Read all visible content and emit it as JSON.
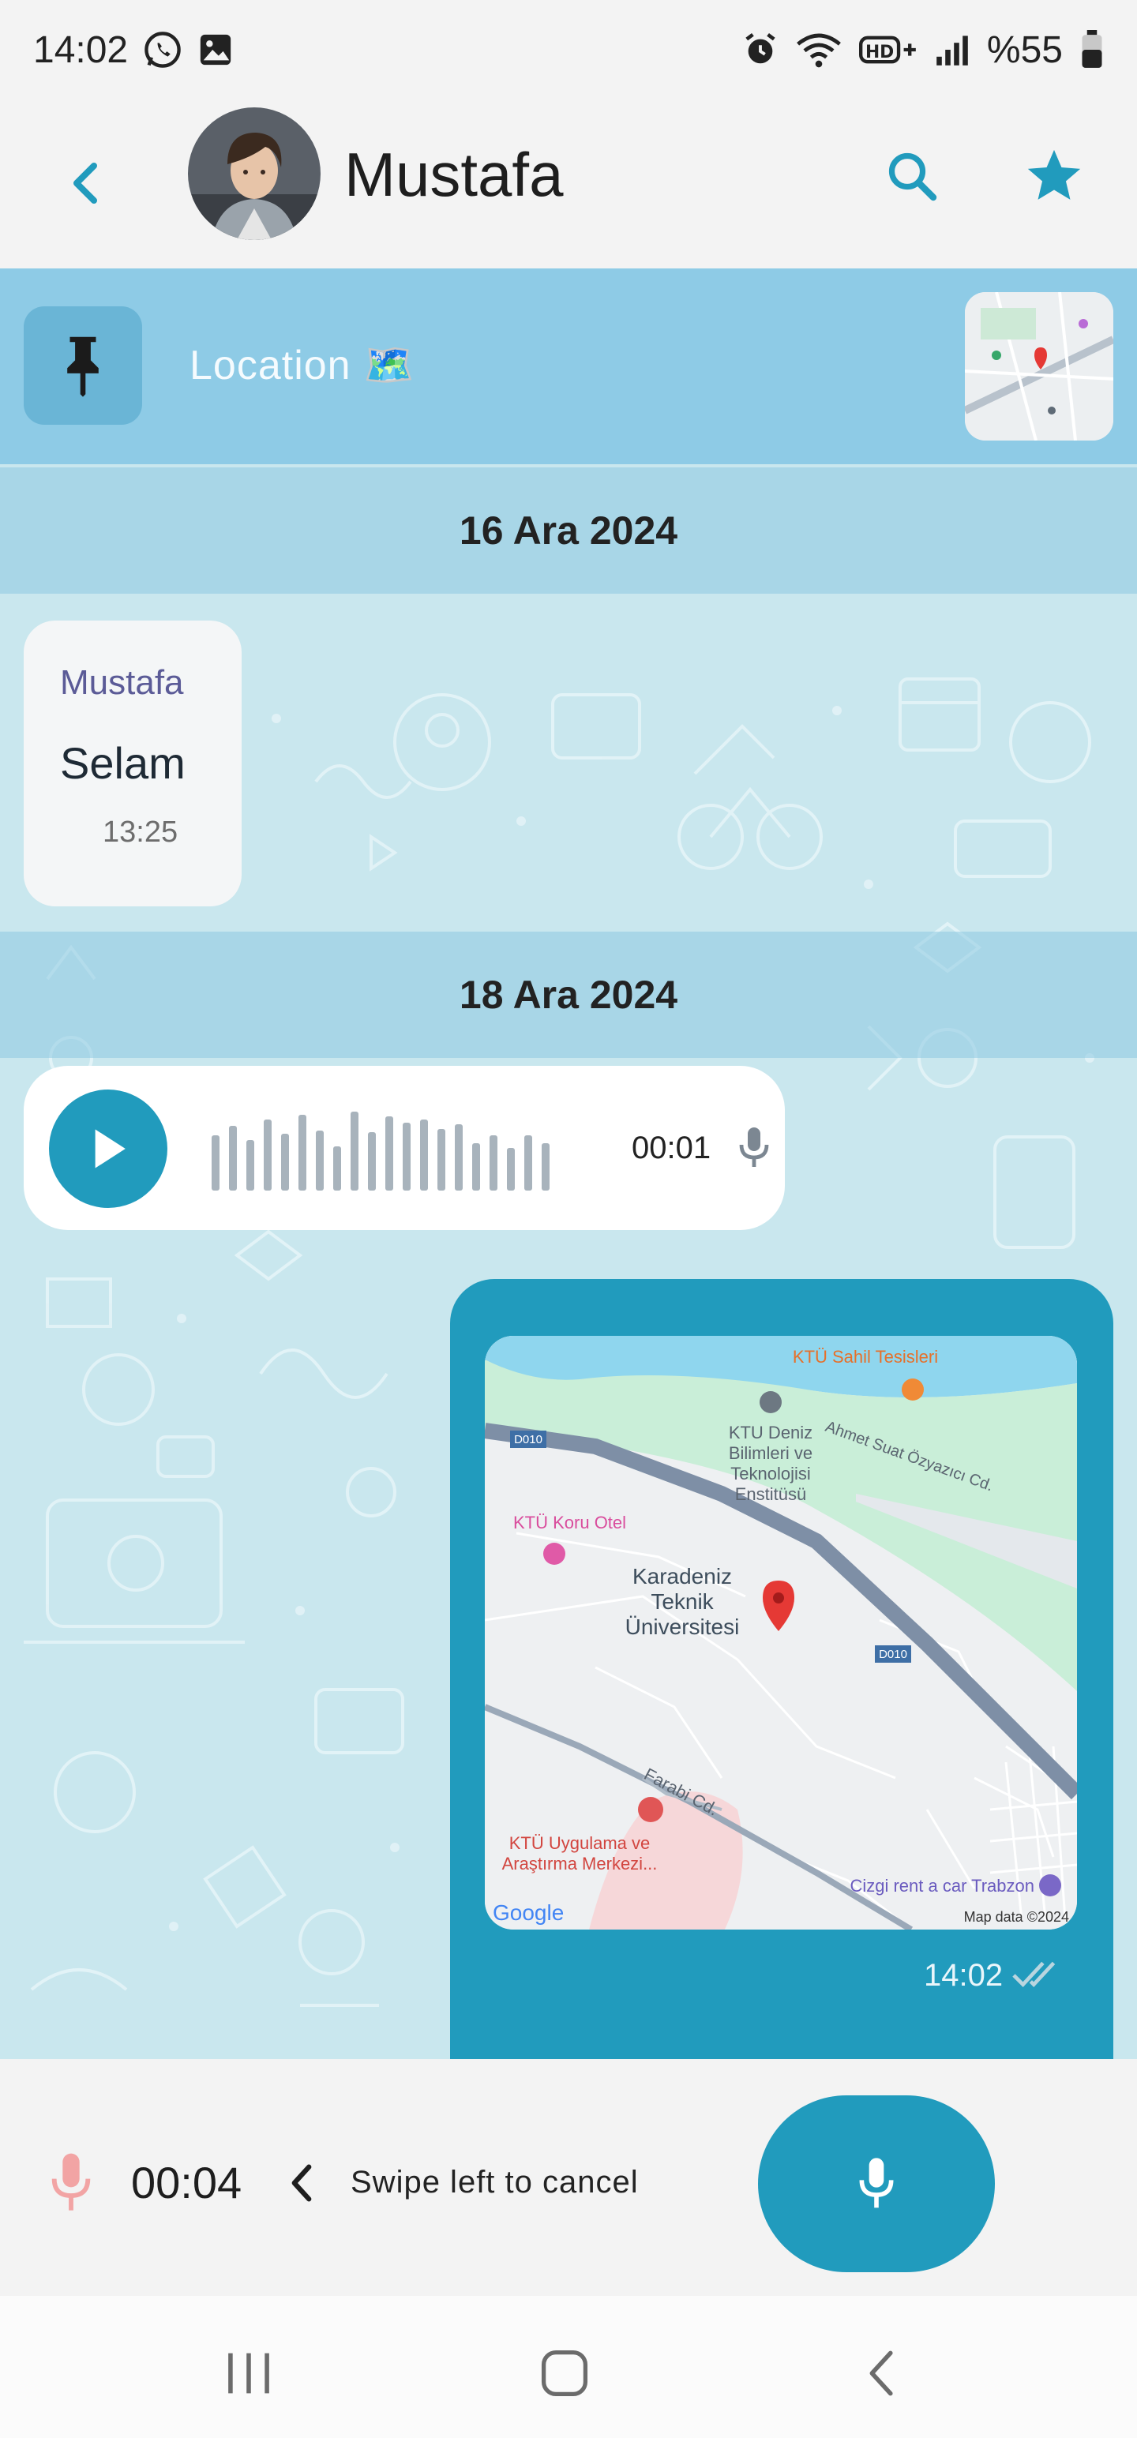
{
  "status_bar": {
    "time": "14:02",
    "battery_text": "%55",
    "icons": [
      "whatsapp-icon",
      "gallery-icon",
      "alarm-icon",
      "wifi-icon",
      "hd-plus-icon",
      "signal-icon",
      "battery-icon"
    ]
  },
  "header": {
    "contact_name": "Mustafa",
    "icons": [
      "back-arrow-icon",
      "search-icon",
      "star-icon"
    ]
  },
  "pinned": {
    "label": "Location 🗺️",
    "icon": "pin-icon"
  },
  "conversation": {
    "date_1": "16 Ara 2024",
    "text_message": {
      "sender": "Mustafa",
      "body": "Selam",
      "time": "13:25"
    },
    "date_2": "18 Ara 2024",
    "voice_message": {
      "duration": "00:01",
      "icons": [
        "play-icon",
        "microphone-icon"
      ]
    },
    "location_message": {
      "time": "14:02",
      "status": "read",
      "map_labels": {
        "poi_1": "KTÜ Sahil Tesisleri",
        "poi_2a": "KTU Deniz",
        "poi_2b": "Bilimleri ve",
        "poi_2c": "Teknolojisi",
        "poi_2d": "Enstitüsü",
        "road_1": "Ahmet Suat Özyazıcı Cd.",
        "road_code_1": "D010",
        "road_code_2": "D010",
        "poi_3": "KTÜ Koru Otel",
        "poi_4a": "Karadeniz",
        "poi_4b": "Teknik",
        "poi_4c": "Üniversitesi",
        "road_2": "Farabi Cd.",
        "poi_5a": "KTÜ Uygulama ve",
        "poi_5b": "Araştırma Merkezi...",
        "poi_6": "Cizgi rent a car Trabzon",
        "logo": "Google",
        "attribution": "Map data ©2024"
      }
    }
  },
  "recording": {
    "timer": "00:04",
    "hint": "Swipe left to cancel",
    "icons": [
      "microphone-icon",
      "chevron-left-icon",
      "microphone-icon"
    ]
  },
  "colors": {
    "accent": "#219bbd",
    "pinned_bar": "#8ecbe6",
    "chat_background": "#c9e7ee",
    "recording_mic": "#f2a4a4"
  },
  "nav_bar": {
    "icons": [
      "recent-apps-icon",
      "home-icon",
      "back-icon"
    ]
  }
}
